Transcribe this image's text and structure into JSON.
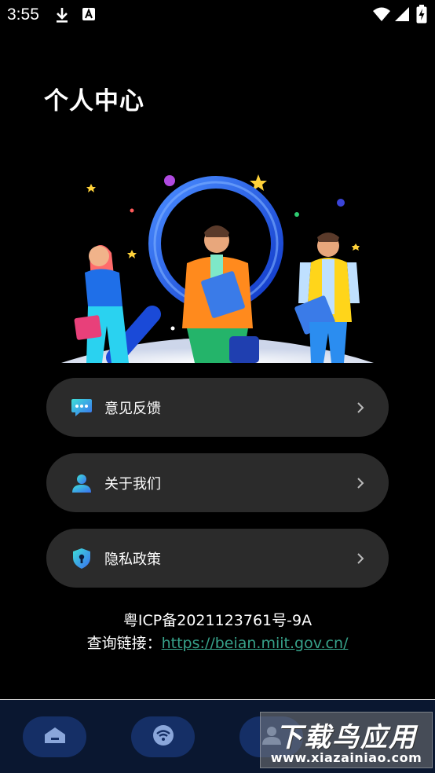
{
  "status_bar": {
    "time": "3:55",
    "icons": [
      "download-icon",
      "text-a-icon",
      "wifi-icon",
      "signal-icon",
      "battery-charging-icon"
    ]
  },
  "page": {
    "title": "个人中心"
  },
  "hero": {
    "image": "person-center-illustration"
  },
  "menu": {
    "items": [
      {
        "label": "意见反馈",
        "icon": "feedback-chat-icon"
      },
      {
        "label": "关于我们",
        "icon": "user-profile-icon"
      },
      {
        "label": "隐私政策",
        "icon": "privacy-shield-icon"
      }
    ],
    "chevron": "chevron-right-icon"
  },
  "footer": {
    "icp": "粤ICP备2021123761号-9A",
    "query_label": "查询链接：",
    "query_url": "https://beian.miit.gov.cn/"
  },
  "tab_bar": {
    "tabs": [
      {
        "icon": "home-icon"
      },
      {
        "icon": "wifi-icon"
      },
      {
        "icon": "profile-icon"
      }
    ]
  },
  "watermark": {
    "main": "下载鸟应用",
    "sub": "www.xiazainiao.com"
  },
  "colors": {
    "background": "#000000",
    "card": "#2b2b2b",
    "link": "#37a28a",
    "tab_bar": "#0a1730",
    "tab_button": "#152f66"
  }
}
